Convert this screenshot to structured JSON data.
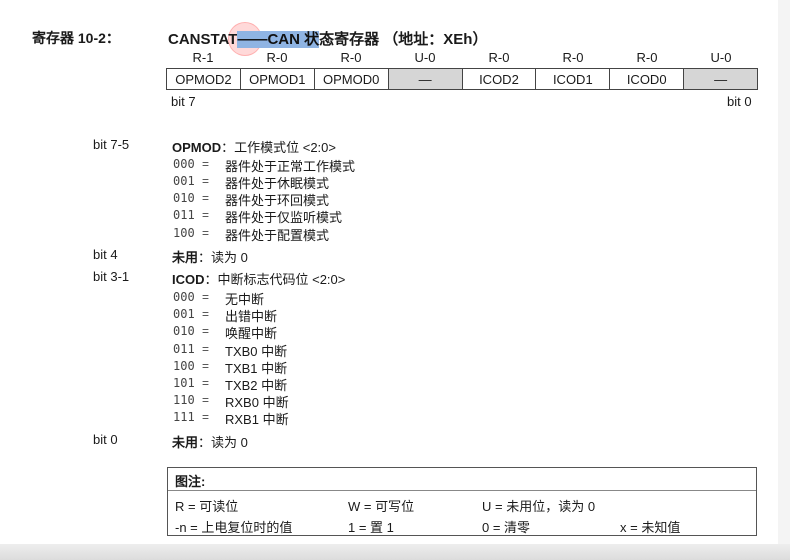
{
  "register": {
    "label": "寄存器 10-2：",
    "title_prefix": "CANSTAT",
    "title_highlight": "——CAN 状",
    "title_suffix": "态寄存器 （地址：XEh）"
  },
  "access": [
    "R-1",
    "R-0",
    "R-0",
    "U-0",
    "R-0",
    "R-0",
    "R-0",
    "U-0"
  ],
  "bits": [
    {
      "name": "OPMOD2",
      "gray": false
    },
    {
      "name": "OPMOD1",
      "gray": false
    },
    {
      "name": "OPMOD0",
      "gray": false
    },
    {
      "name": "—",
      "gray": true
    },
    {
      "name": "ICOD2",
      "gray": false
    },
    {
      "name": "ICOD1",
      "gray": false
    },
    {
      "name": "ICOD0",
      "gray": false
    },
    {
      "name": "—",
      "gray": true
    }
  ],
  "bit_high": "bit 7",
  "bit_low": "bit 0",
  "definitions": {
    "opmod": {
      "bit": "bit 7-5",
      "name": "OPMOD",
      "desc": "：工作模式位 <2:0>",
      "items": [
        {
          "code": "000",
          "eq": "=",
          "text": "器件处于正常工作模式"
        },
        {
          "code": "001",
          "eq": "=",
          "text": "器件处于休眠模式"
        },
        {
          "code": "010",
          "eq": "=",
          "text": "器件处于环回模式"
        },
        {
          "code": "011",
          "eq": "=",
          "text": "器件处于仅监听模式"
        },
        {
          "code": "100",
          "eq": "=",
          "text": "器件处于配置模式"
        }
      ]
    },
    "bit4": {
      "bit": "bit 4",
      "name": "未用",
      "desc": "：读为 0"
    },
    "icod": {
      "bit": "bit 3-1",
      "name": "ICOD",
      "desc": "：中断标志代码位 <2:0>",
      "items": [
        {
          "code": "000",
          "eq": "=",
          "text": "无中断"
        },
        {
          "code": "001",
          "eq": "=",
          "text": "出错中断"
        },
        {
          "code": "010",
          "eq": "=",
          "text": "唤醒中断"
        },
        {
          "code": "011",
          "eq": "=",
          "text": "TXB0 中断"
        },
        {
          "code": "100",
          "eq": "=",
          "text": "TXB1 中断"
        },
        {
          "code": "101",
          "eq": "=",
          "text": "TXB2 中断"
        },
        {
          "code": "110",
          "eq": "=",
          "text": "RXB0 中断"
        },
        {
          "code": "111",
          "eq": "=",
          "text": "RXB1 中断"
        }
      ]
    },
    "bit0": {
      "bit": "bit 0",
      "name": "未用",
      "desc": "：读为 0"
    }
  },
  "legend": {
    "title": "图注:",
    "r": "R = 可读位",
    "w": "W = 可写位",
    "u": "U = 未用位，读为 0",
    "n": "-n = 上电复位时的值",
    "one": "1 = 置 1",
    "zero": "0 = 清零",
    "x": "x = 未知值"
  }
}
